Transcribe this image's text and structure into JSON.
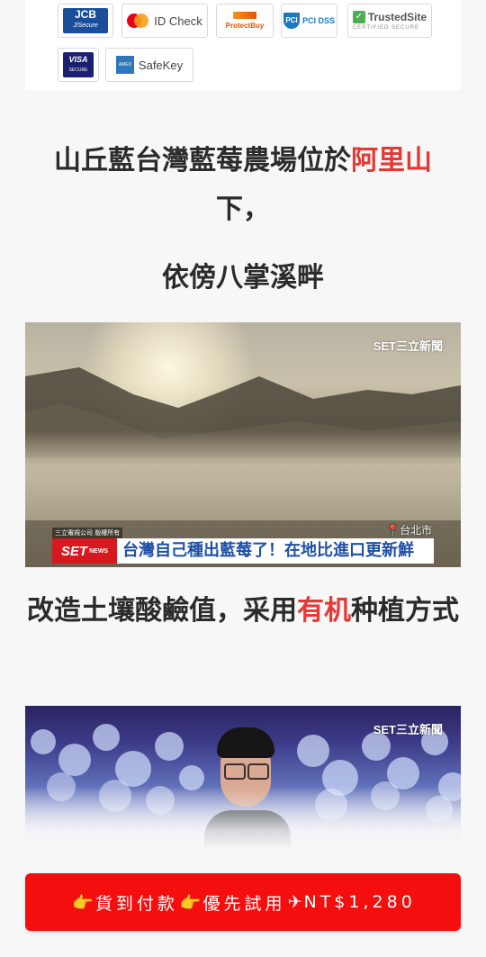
{
  "payment_badges": {
    "jcb": {
      "name": "JCB",
      "sub": "J/Secure"
    },
    "mastercard": {
      "label": "ID Check"
    },
    "discover": {
      "label": "ProtectBuy"
    },
    "pci": {
      "label": "PCI DSS"
    },
    "trustedsite": {
      "name": "TrustedSite",
      "sub": "CERTIFIED SECURE"
    },
    "visa": {
      "name": "VISA",
      "sub": "SECURE"
    },
    "amex": {
      "label": "SafeKey"
    }
  },
  "heading1": {
    "text_before": "山丘藍台灣藍莓農場位於",
    "text_highlight": "阿里山",
    "text_after": "下，"
  },
  "heading2": {
    "text": "依傍八掌溪畔"
  },
  "image1": {
    "logo": "SET三立新聞",
    "location": "台北市",
    "source": "三立電視公司 版權所有",
    "news_brand": "SET",
    "news_brand_sub": "NEWS",
    "headline": "台灣自己種出藍莓了！在地比進口更新鮮"
  },
  "heading3": {
    "text_before": "改造土壤酸鹼值，采用",
    "text_highlight": "有机",
    "text_after": "种植方式"
  },
  "image2": {
    "logo": "SET三立新聞"
  },
  "cta": {
    "hand_icon": "👉",
    "label_part1": "貨到付款",
    "label_part2": "優先試用",
    "plane_icon": "✈",
    "price": "NT$1,280"
  },
  "colors": {
    "highlight": "#e53935",
    "cta_bg": "#f40e0e",
    "text": "#2b2b2b"
  }
}
